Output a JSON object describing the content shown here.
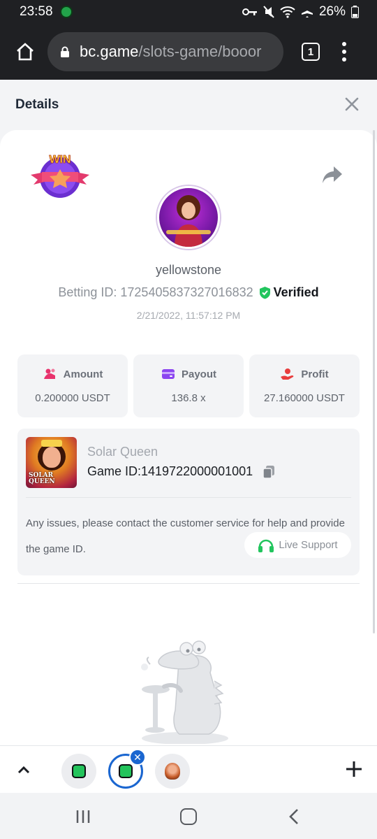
{
  "status_bar": {
    "time": "23:58",
    "battery": "26%"
  },
  "browser": {
    "url_domain": "bc.game",
    "url_path": "/slots-game/booor",
    "tab_count": "1"
  },
  "details": {
    "title": "Details",
    "win_badge_text": "WIN",
    "username": "yellowstone",
    "betting_id_label": "Betting ID: 1725405837327016832",
    "verified_label": "Verified",
    "timestamp": "2/21/2022, 11:57:12 PM"
  },
  "stats": [
    {
      "label": "Amount",
      "value": "0.200000 USDT",
      "icon": "coins-icon",
      "color": "#e8336d"
    },
    {
      "label": "Payout",
      "value": "136.8 x",
      "icon": "wallet-icon",
      "color": "#8b45f0"
    },
    {
      "label": "Profit",
      "value": "27.160000 USDT",
      "icon": "profit-hand-icon",
      "color": "#e83d3d"
    }
  ],
  "game": {
    "name": "Solar Queen",
    "game_id": "Game ID:1419722000001001",
    "thumb_label_1": "SOLAR",
    "thumb_label_2": "QUEEN",
    "issue_text": "Any issues, please contact the customer service for help and provide the game ID.",
    "live_support": "Live Support"
  },
  "colors": {
    "accent_green": "#22c55e",
    "active_tab_blue": "#1a66d0"
  }
}
